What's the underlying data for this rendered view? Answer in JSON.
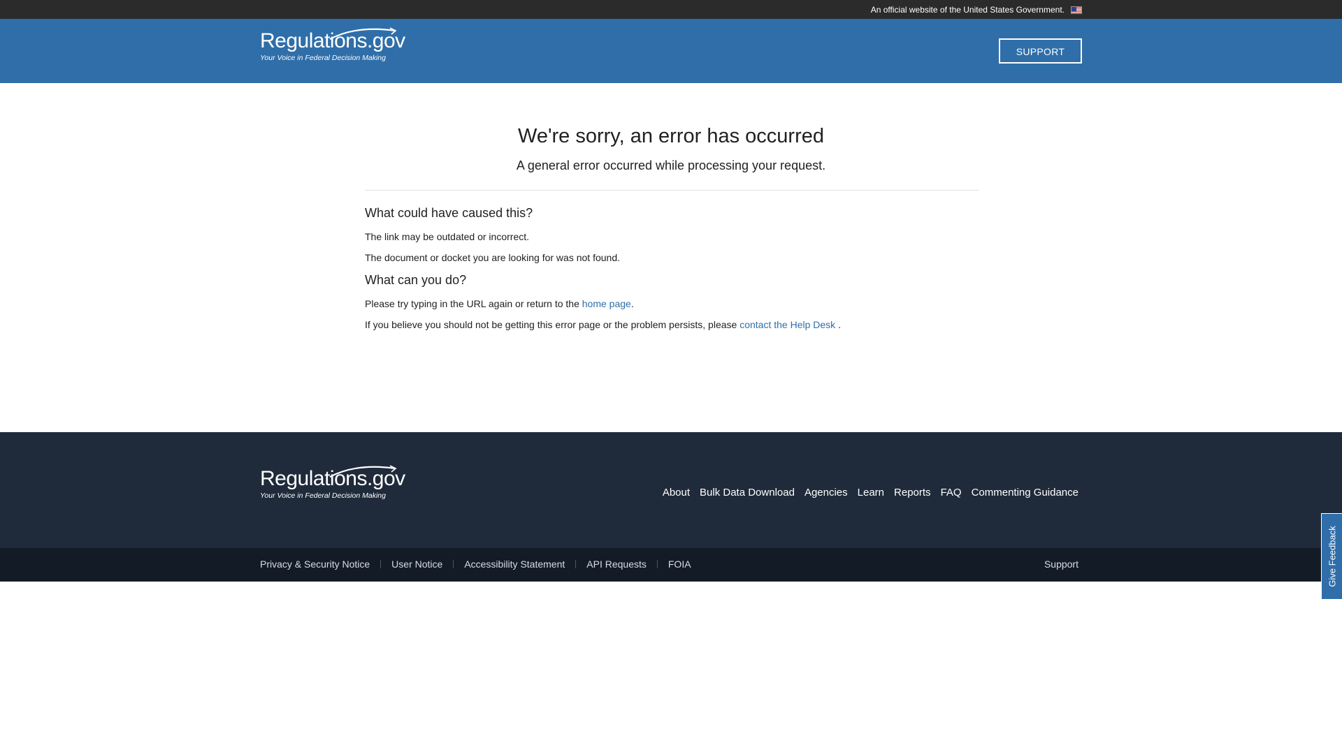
{
  "gov_banner": {
    "text": "An official website of the United States Government.",
    "flag_icon": "us-flag-icon"
  },
  "header": {
    "logo_name": "Regulations.gov",
    "logo_tagline": "Your Voice in Federal Decision Making",
    "support_label": "SUPPORT"
  },
  "main": {
    "title": "We're sorry, an error has occurred",
    "subtitle": "A general error occurred while processing your request.",
    "cause": {
      "heading": "What could have caused this?",
      "items": [
        "The link may be outdated or incorrect.",
        "The document or docket you are looking for was not found."
      ]
    },
    "action": {
      "heading": "What can you do?",
      "line1_prefix": "Please try typing in the URL again or return to the ",
      "line1_link": "home page",
      "line1_suffix": ".",
      "line2_prefix": "If you believe you should not be getting this error page or the problem persists, please ",
      "line2_link": "contact the Help Desk",
      "line2_suffix": " ."
    }
  },
  "footer": {
    "logo_name": "Regulations.gov",
    "logo_tagline": "Your Voice in Federal Decision Making",
    "nav": [
      "About",
      "Bulk Data Download",
      "Agencies",
      "Learn",
      "Reports",
      "FAQ",
      "Commenting Guidance"
    ],
    "legal": [
      "Privacy & Security Notice",
      "User Notice",
      "Accessibility Statement",
      "API Requests",
      "FOIA"
    ],
    "support": "Support"
  },
  "feedback_tab": {
    "label": "Give Feedback"
  },
  "colors": {
    "header_blue": "#2f6ea9",
    "banner_dark": "#2b2b2b",
    "footer_top": "#1f2a3a",
    "footer_bottom": "#131b26",
    "link_blue": "#2f6ea9"
  }
}
